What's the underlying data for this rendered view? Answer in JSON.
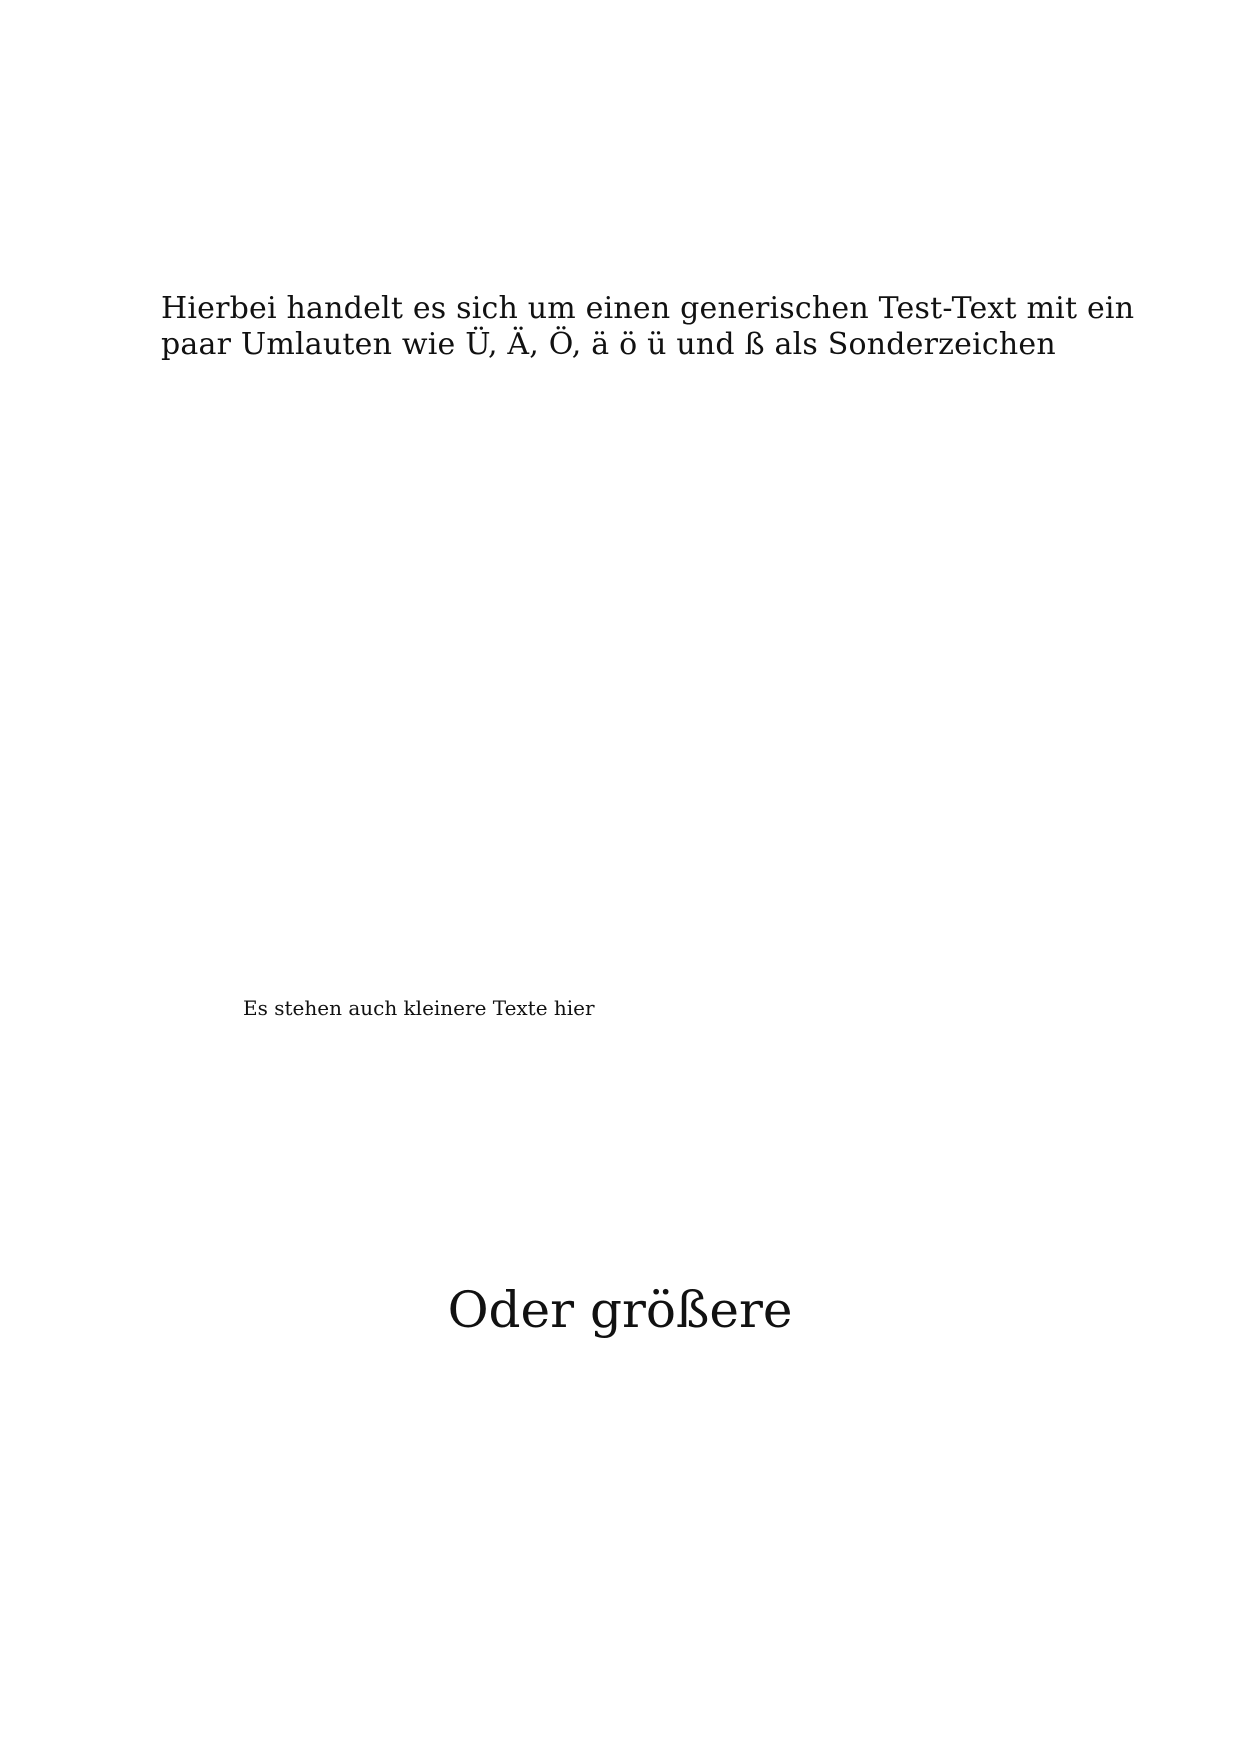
{
  "document": {
    "paragraph_lines": [
      "Hierbei handelt es sich um einen generischen Test-Text mit ein",
      "paar Umlauten wie Ü, Ä, Ö, ä ö ü und ß als Sonderzeichen"
    ],
    "small_text": "Es stehen auch kleinere Texte hier",
    "large_text": "Oder größere"
  }
}
